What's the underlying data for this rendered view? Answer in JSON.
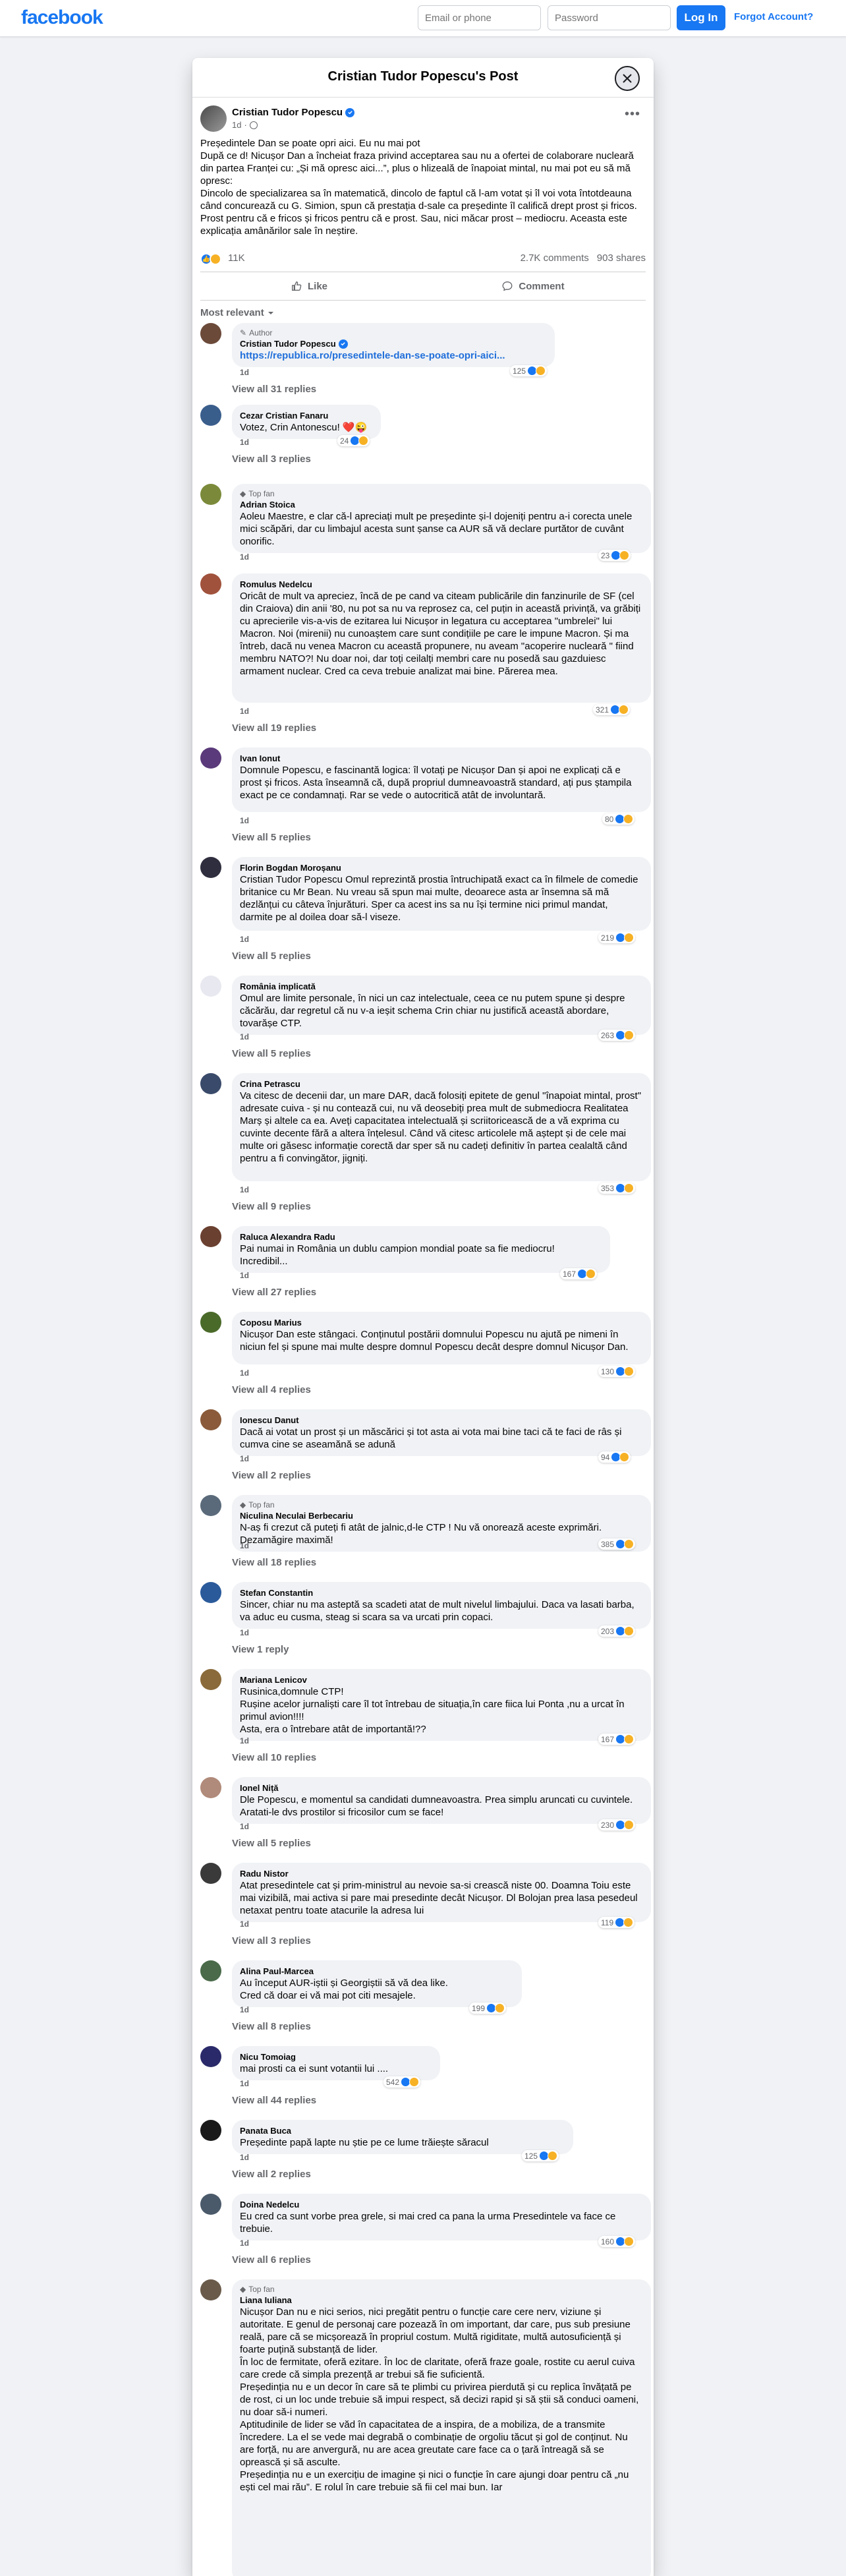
{
  "topbar": {
    "logo": "facebook",
    "email_placeholder": "Email or phone",
    "password_placeholder": "Password",
    "login_label": "Log In",
    "forgot_label": "Forgot Account?"
  },
  "modal": {
    "title": "Cristian Tudor Popescu's Post"
  },
  "post": {
    "author": "Cristian Tudor Popescu",
    "time": "1d",
    "paragraphs": [
      "Președintele Dan se poate opri aici. Eu nu mai pot",
      "",
      " După ce d! Nicușor Dan a încheiat fraza privind acceptarea sau nu a ofertei de colaborare nucleară din partea Franței cu: „Și mă opresc aici...”, plus o hlizeală de înapoiat mintal, nu mai pot eu să mă opresc:",
      " Dincolo de specializarea sa în matematică, dincolo de faptul că l-am votat și îl voi vota întotdeauna când concurează cu G. Simion, spun că prestația d-sale ca președinte îl califică drept prost și fricos. Prost pentru că e fricos și fricos pentru că e prost. Sau, nici măcar prost – mediocru. Aceasta este explicația amânărilor sale în neștire."
    ],
    "reaction_count": "11K",
    "comments_count": "2.7K comments",
    "shares_count": "903 shares",
    "like_label": "Like",
    "comment_label": "Comment",
    "sort_label": "Most relevant"
  },
  "comments": [
    {
      "badge": "Author",
      "name": "Cristian Tudor Popescu",
      "text": "",
      "link": "https://republica.ro/presedintele-dan-se-poate-opri-aici...",
      "time": "1d",
      "reacts": "125",
      "replies": "View all 31 replies"
    },
    {
      "badge": "",
      "name": "Cezar Cristian Fanaru",
      "text": "Votez, Crin Antonescu! ❤️😜",
      "link": "",
      "time": "1d",
      "reacts": "24",
      "replies": "View all 3 replies"
    },
    {
      "badge": "Top fan",
      "name": "Adrian Stoica",
      "text": "Aoleu Maestre, e clar că-l apreciați mult pe președinte și-l dojeniți pentru a-i corecta unele mici scăpări, dar cu limbajul acesta sunt șanse ca AUR să vă declare purtător de cuvânt onorific.",
      "link": "",
      "time": "1d",
      "reacts": "23",
      "replies": ""
    },
    {
      "badge": "",
      "name": "Romulus Nedelcu",
      "text": "Oricât de mult va apreciez, încă de pe cand va citeam publicările din fanzinurile de SF (cel din Craiova) din anii '80, nu pot sa nu va reprosez ca, cel puțin in această privință, va grăbiți cu aprecierile vis-a-vis de ezitarea lui Nicușor in legatura cu acceptarea \"umbrelei\" lui Macron. Noi (mirenii) nu cunoaștem care sunt condițiile pe care le impune Macron. Și ma întreb, dacă nu venea Macron cu această propunere, nu aveam \"acoperire nucleară \" fiind membru NATO?! Nu doar noi, dar toți ceilalți membri care nu posedă sau gazduiesc armament nuclear. Cred ca ceva trebuie analizat mai bine. Părerea mea.",
      "link": "",
      "time": "1d",
      "reacts": "321",
      "replies": "View all 19 replies"
    },
    {
      "badge": "",
      "name": "Ivan Ionut",
      "text": "Domnule Popescu, e fascinantă logica: îl votați pe Nicușor Dan și apoi ne explicați că e prost și fricos. Asta înseamnă că, după propriul dumneavoastră standard, ați pus ștampila exact pe ce condamnați. Rar se vede o autocritică atât de involuntară.",
      "link": "",
      "time": "1d",
      "reacts": "80",
      "replies": "View all 5 replies"
    },
    {
      "badge": "",
      "name": "Florin Bogdan Moroșanu",
      "text": "Cristian Tudor Popescu Omul reprezintă prostia întruchipată exact ca în filmele de comedie britanice cu Mr Bean. Nu vreau să spun mai multe, deoarece asta ar însemna să mă dezlănțui cu câteva înjurături. Sper ca acest ins sa nu își termine nici primul mandat, darmite pe al doilea doar să-l viseze.",
      "link": "",
      "time": "1d",
      "reacts": "219",
      "replies": "View all 5 replies"
    },
    {
      "badge": "",
      "name": "România implicată",
      "text": "Omul are limite personale, în nici un caz intelectuale, ceea ce nu putem spune și despre căcărău, dar regretul că nu v-a ieșit schema Crin chiar nu justifică această abordare, tovarășe CTP.",
      "link": "",
      "time": "1d",
      "reacts": "263",
      "replies": "View all 5 replies"
    },
    {
      "badge": "",
      "name": "Crina Petrascu",
      "text": "Va citesc de decenii dar, un mare DAR, dacă folosiți epitete de genul \"înapoiat mintal, prost\" adresate cuiva - și nu contează cui, nu vă deosebiți prea mult de submediocra Realitatea Marș și altele ca ea. Aveți capacitatea intelectuală și scriitoricească de a vă exprima cu cuvinte decente fără a altera înțelesul. Când vă citesc articolele mă aștept și de cele mai multe ori găsesc informație corectă dar sper să nu cadeți definitiv în partea cealaltă când pentru a fi convingător, jigniți.",
      "link": "",
      "time": "1d",
      "reacts": "353",
      "replies": "View all 9 replies"
    },
    {
      "badge": "",
      "name": "Raluca Alexandra Radu",
      "text": "Pai numai in România un dublu campion mondial poate sa fie mediocru! Incredibil...",
      "link": "",
      "time": "1d",
      "reacts": "167",
      "replies": "View all 27 replies"
    },
    {
      "badge": "",
      "name": "Coposu Marius",
      "text": "Nicușor Dan este stângaci. Conținutul postării domnului Popescu nu ajută pe nimeni în niciun fel și spune mai multe despre domnul Popescu decât despre domnul Nicușor Dan.",
      "link": "",
      "time": "1d",
      "reacts": "130",
      "replies": "View all 4 replies"
    },
    {
      "badge": "",
      "name": "Ionescu Danut",
      "text": "Dacă ai votat un prost și un măscărici și tot asta ai vota mai bine taci că te faci de râs și cumva cine se aseamănă se adună",
      "link": "",
      "time": "1d",
      "reacts": "94",
      "replies": "View all 2 replies"
    },
    {
      "badge": "Top fan",
      "name": "Niculina Neculai Berbecariu",
      "text": "N-aș fi crezut că puteți fi atât de jalnic,d-le CTP ! Nu vă onorează aceste exprimări. Dezamăgire maximă!",
      "link": "",
      "time": "1d",
      "reacts": "385",
      "replies": "View all 18 replies"
    },
    {
      "badge": "",
      "name": "Stefan Constantin",
      "text": "Sincer, chiar nu ma asteptă sa scadeti atat de mult nivelul limbajului. Daca va lasati barba, va aduc eu cusma, steag si scara sa va urcati prin copaci.",
      "link": "",
      "time": "1d",
      "reacts": "203",
      "replies": "View 1 reply"
    },
    {
      "badge": "",
      "name": "Mariana Lenicov",
      "text": "Rusinica,domnule CTP!\nRușine acelor jurnaliști care îl tot întrebau de situația,în care fiica lui Ponta ,nu a urcat în primul avion!!!!\nAsta, era o întrebare atât de importantă!??",
      "link": "",
      "time": "1d",
      "reacts": "167",
      "replies": "View all 10 replies"
    },
    {
      "badge": "",
      "name": "Ionel Niță",
      "text": "Dle Popescu, e momentul sa candidati dumneavoastra. Prea simplu aruncati cu cuvintele. Aratati-le dvs prostilor si fricosilor cum se face!",
      "link": "",
      "time": "1d",
      "reacts": "230",
      "replies": "View all 5 replies"
    },
    {
      "badge": "",
      "name": "Radu Nistor",
      "text": "Atat presedintele cat și prim-ministrul au nevoie sa-si crească niste 00. Doamna Toiu este mai vizibilă, mai activa si pare mai presedinte decât Nicușor. Dl Bolojan prea lasa pesedeul netaxat pentru toate atacurile la adresa lui",
      "link": "",
      "time": "1d",
      "reacts": "119",
      "replies": "View all 3 replies"
    },
    {
      "badge": "",
      "name": "Alina Paul-Marcea",
      "text": "Au început AUR-iștii și Georgiștii să vă dea like.\nCred că doar ei vă mai pot citi mesajele.",
      "link": "",
      "time": "1d",
      "reacts": "199",
      "replies": "View all 8 replies"
    },
    {
      "badge": "",
      "name": "Nicu Tomoiag",
      "text": "mai prosti ca ei sunt votantii lui ....",
      "link": "",
      "time": "1d",
      "reacts": "542",
      "replies": "View all 44 replies"
    },
    {
      "badge": "",
      "name": "Panata Buca",
      "text": "Președinte papă lapte nu știe pe ce lume trăiește săracul",
      "link": "",
      "time": "1d",
      "reacts": "125",
      "replies": "View all 2 replies"
    },
    {
      "badge": "",
      "name": "Doina Nedelcu",
      "text": "Eu cred ca sunt vorbe prea grele, si mai cred ca pana la urma Presedintele va face ce trebuie.",
      "link": "",
      "time": "1d",
      "reacts": "160",
      "replies": "View all 6 replies"
    },
    {
      "badge": "Top fan",
      "name": "Liana Iuliana",
      "text": "Nicușor Dan nu e nici serios, nici pregătit pentru o funcție care cere nerv, viziune și autoritate. E genul de personaj care pozează în om important, dar care, pus sub presiune reală, pare că se micșorează în propriul costum. Multă rigiditate, multă autosuficiență și foarte puțină substanță de lider.\nÎn loc de fermitate, oferă ezitare. În loc de claritate, oferă fraze goale, rostite cu aerul cuiva care crede că simpla prezență ar trebui să fie suficientă.\nPreședinția nu e un decor în care să te plimbi cu privirea pierdută și cu replica învățată pe de rost, ci un loc unde trebuie să impui respect, să decizi rapid și să știi să conduci oameni, nu doar să-i numeri.\nAptitudinile de lider se văd în capacitatea de a inspira, de a mobiliza, de a transmite încredere. La el se vede mai degrabă o combinație de orgoliu tăcut și gol de conținut. Nu are forță, nu are anvergură, nu are acea greutate care face ca o țară întreagă să se oprească și să asculte.\nPreședinția nu e un exercițiu de imagine și nici o funcție în care ajungi doar pentru că „nu ești cel mai rău”. E rolul în care trebuie să fii cel mai bun. Iar",
      "link": "",
      "time": "",
      "reacts": "",
      "replies": ""
    }
  ],
  "colors": {
    "brand": "#1877f2",
    "bubble": "#f0f2f5",
    "muted": "#65676b"
  },
  "icons": [
    "close-icon",
    "verified-icon",
    "globe-icon",
    "more-icon",
    "like-icon",
    "comment-icon",
    "chevron-down-icon"
  ]
}
